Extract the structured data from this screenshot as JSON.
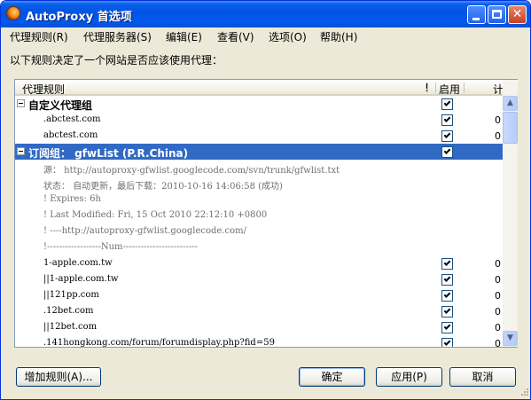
{
  "window": {
    "title": "AutoProxy 首选项"
  },
  "menu": [
    "代理规则(R)",
    "代理服务器(S)",
    "编辑(E)",
    "查看(V)",
    "选项(O)",
    "帮助(H)"
  ],
  "intro_text": "以下规则决定了一个网站是否应该使用代理：",
  "tree": {
    "headers": {
      "rule": "代理规则",
      "bang": "!",
      "enabled": "启用",
      "count": "计数"
    },
    "rows": [
      {
        "kind": "group",
        "label": "自定义代理组",
        "checked": true,
        "count": ""
      },
      {
        "kind": "rule",
        "text": ".abctest.com",
        "checked": true,
        "count": "0"
      },
      {
        "kind": "rule",
        "text": "abctest.com",
        "checked": true,
        "count": "0"
      },
      {
        "kind": "group",
        "label": "订阅组： gfwList (P.R.China)",
        "checked": true,
        "count": "",
        "selected": true
      },
      {
        "kind": "comment",
        "text": "源： http://autoproxy-gfwlist.googlecode.com/svn/trunk/gfwlist.txt"
      },
      {
        "kind": "comment",
        "text": "状态： 自动更新，最后下载：2010-10-16 14:06:58 (成功)"
      },
      {
        "kind": "comment",
        "text": "! Expires: 6h"
      },
      {
        "kind": "comment",
        "text": "! Last Modified: Fri, 15 Oct 2010 22:12:10 +0800"
      },
      {
        "kind": "comment",
        "text": "!     ----http://autoproxy-gfwlist.googlecode.com/"
      },
      {
        "kind": "comment",
        "text": "!------------------Num-------------------------"
      },
      {
        "kind": "rule",
        "text": "1-apple.com.tw",
        "checked": true,
        "count": "0"
      },
      {
        "kind": "rule",
        "text": "||1-apple.com.tw",
        "checked": true,
        "count": "0"
      },
      {
        "kind": "rule",
        "text": "||121pp.com",
        "checked": true,
        "count": "0"
      },
      {
        "kind": "rule",
        "text": ".12bet.com",
        "checked": true,
        "count": "0"
      },
      {
        "kind": "rule",
        "text": "||12bet.com",
        "checked": true,
        "count": "0"
      },
      {
        "kind": "rule",
        "text": ".141hongkong.com/forum/forumdisplay.php?fid=59",
        "checked": true,
        "count": "0"
      }
    ]
  },
  "buttons": {
    "add_rule": "增加规则(A)...",
    "ok": "确定",
    "apply": "应用(P)",
    "cancel": "取消"
  },
  "colors": {
    "selection": "#316ac5",
    "titlebar": "#0054e3"
  }
}
